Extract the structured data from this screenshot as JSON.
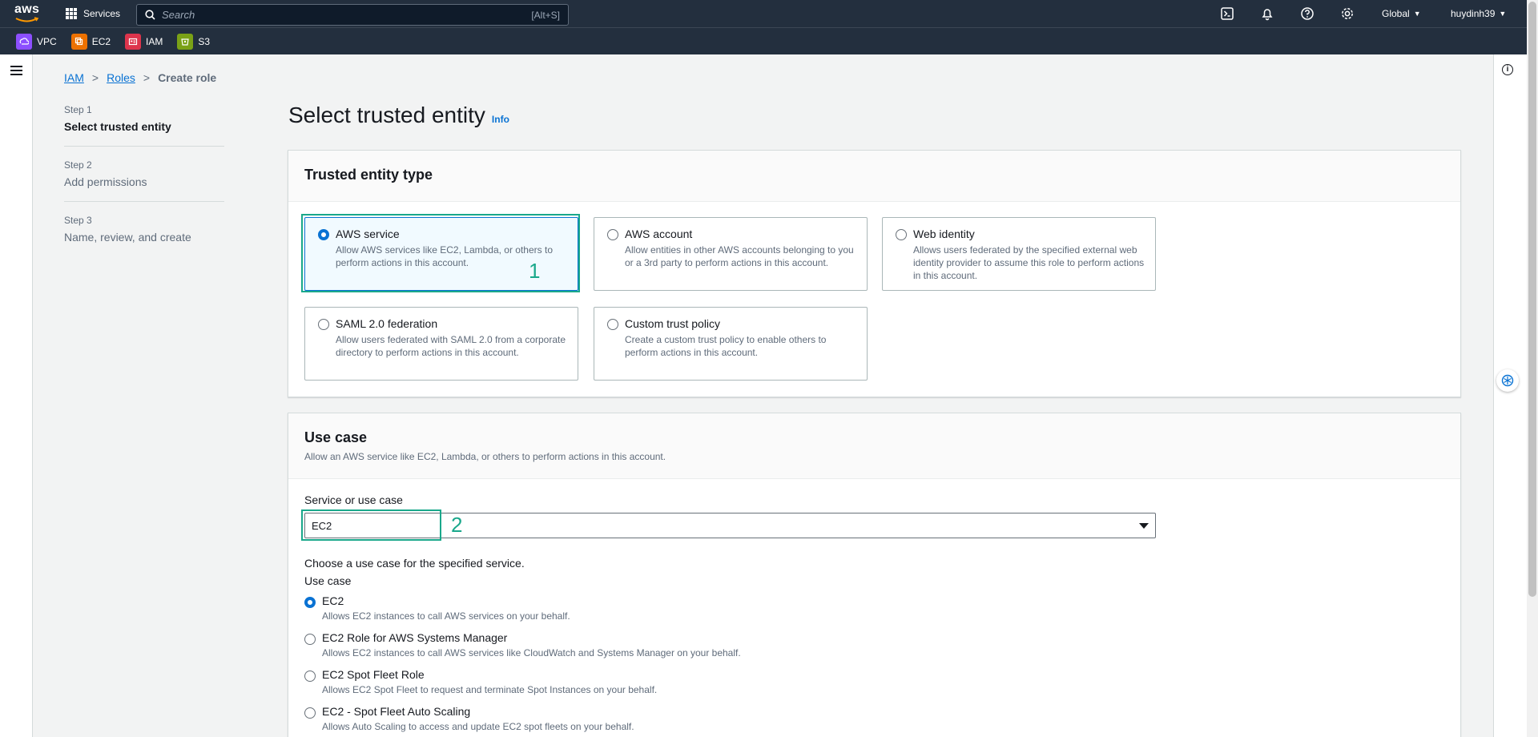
{
  "topnav": {
    "logo_text": "aws",
    "services_label": "Services",
    "search_placeholder": "Search",
    "search_shortcut": "[Alt+S]",
    "region": "Global",
    "user": "huydinh39"
  },
  "favorites": [
    {
      "label": "VPC",
      "color": "#8c4fff"
    },
    {
      "label": "EC2",
      "color": "#ed7100"
    },
    {
      "label": "IAM",
      "color": "#dd344c"
    },
    {
      "label": "S3",
      "color": "#7aa116"
    }
  ],
  "breadcrumb": {
    "items": [
      "IAM",
      "Roles"
    ],
    "current": "Create role"
  },
  "steps": [
    {
      "num": "Step 1",
      "name": "Select trusted entity"
    },
    {
      "num": "Step 2",
      "name": "Add permissions"
    },
    {
      "num": "Step 3",
      "name": "Name, review, and create"
    }
  ],
  "page": {
    "title": "Select trusted entity",
    "info_link": "Info"
  },
  "trusted_entity": {
    "heading": "Trusted entity type",
    "options": [
      {
        "title": "AWS service",
        "desc": "Allow AWS services like EC2, Lambda, or others to perform actions in this account.",
        "selected": true
      },
      {
        "title": "AWS account",
        "desc": "Allow entities in other AWS accounts belonging to you or a 3rd party to perform actions in this account.",
        "selected": false
      },
      {
        "title": "Web identity",
        "desc": "Allows users federated by the specified external web identity provider to assume this role to perform actions in this account.",
        "selected": false
      },
      {
        "title": "SAML 2.0 federation",
        "desc": "Allow users federated with SAML 2.0 from a corporate directory to perform actions in this account.",
        "selected": false
      },
      {
        "title": "Custom trust policy",
        "desc": "Create a custom trust policy to enable others to perform actions in this account.",
        "selected": false
      }
    ]
  },
  "use_case": {
    "heading": "Use case",
    "desc": "Allow an AWS service like EC2, Lambda, or others to perform actions in this account.",
    "service_label": "Service or use case",
    "service_value": "EC2",
    "choose_caption": "Choose a use case for the specified service.",
    "use_case_label": "Use case",
    "options": [
      {
        "title": "EC2",
        "desc": "Allows EC2 instances to call AWS services on your behalf.",
        "selected": true
      },
      {
        "title": "EC2 Role for AWS Systems Manager",
        "desc": "Allows EC2 instances to call AWS services like CloudWatch and Systems Manager on your behalf.",
        "selected": false
      },
      {
        "title": "EC2 Spot Fleet Role",
        "desc": "Allows EC2 Spot Fleet to request and terminate Spot Instances on your behalf.",
        "selected": false
      },
      {
        "title": "EC2 - Spot Fleet Auto Scaling",
        "desc": "Allows Auto Scaling to access and update EC2 spot fleets on your behalf.",
        "selected": false
      }
    ]
  },
  "annotations": [
    "1",
    "2"
  ]
}
